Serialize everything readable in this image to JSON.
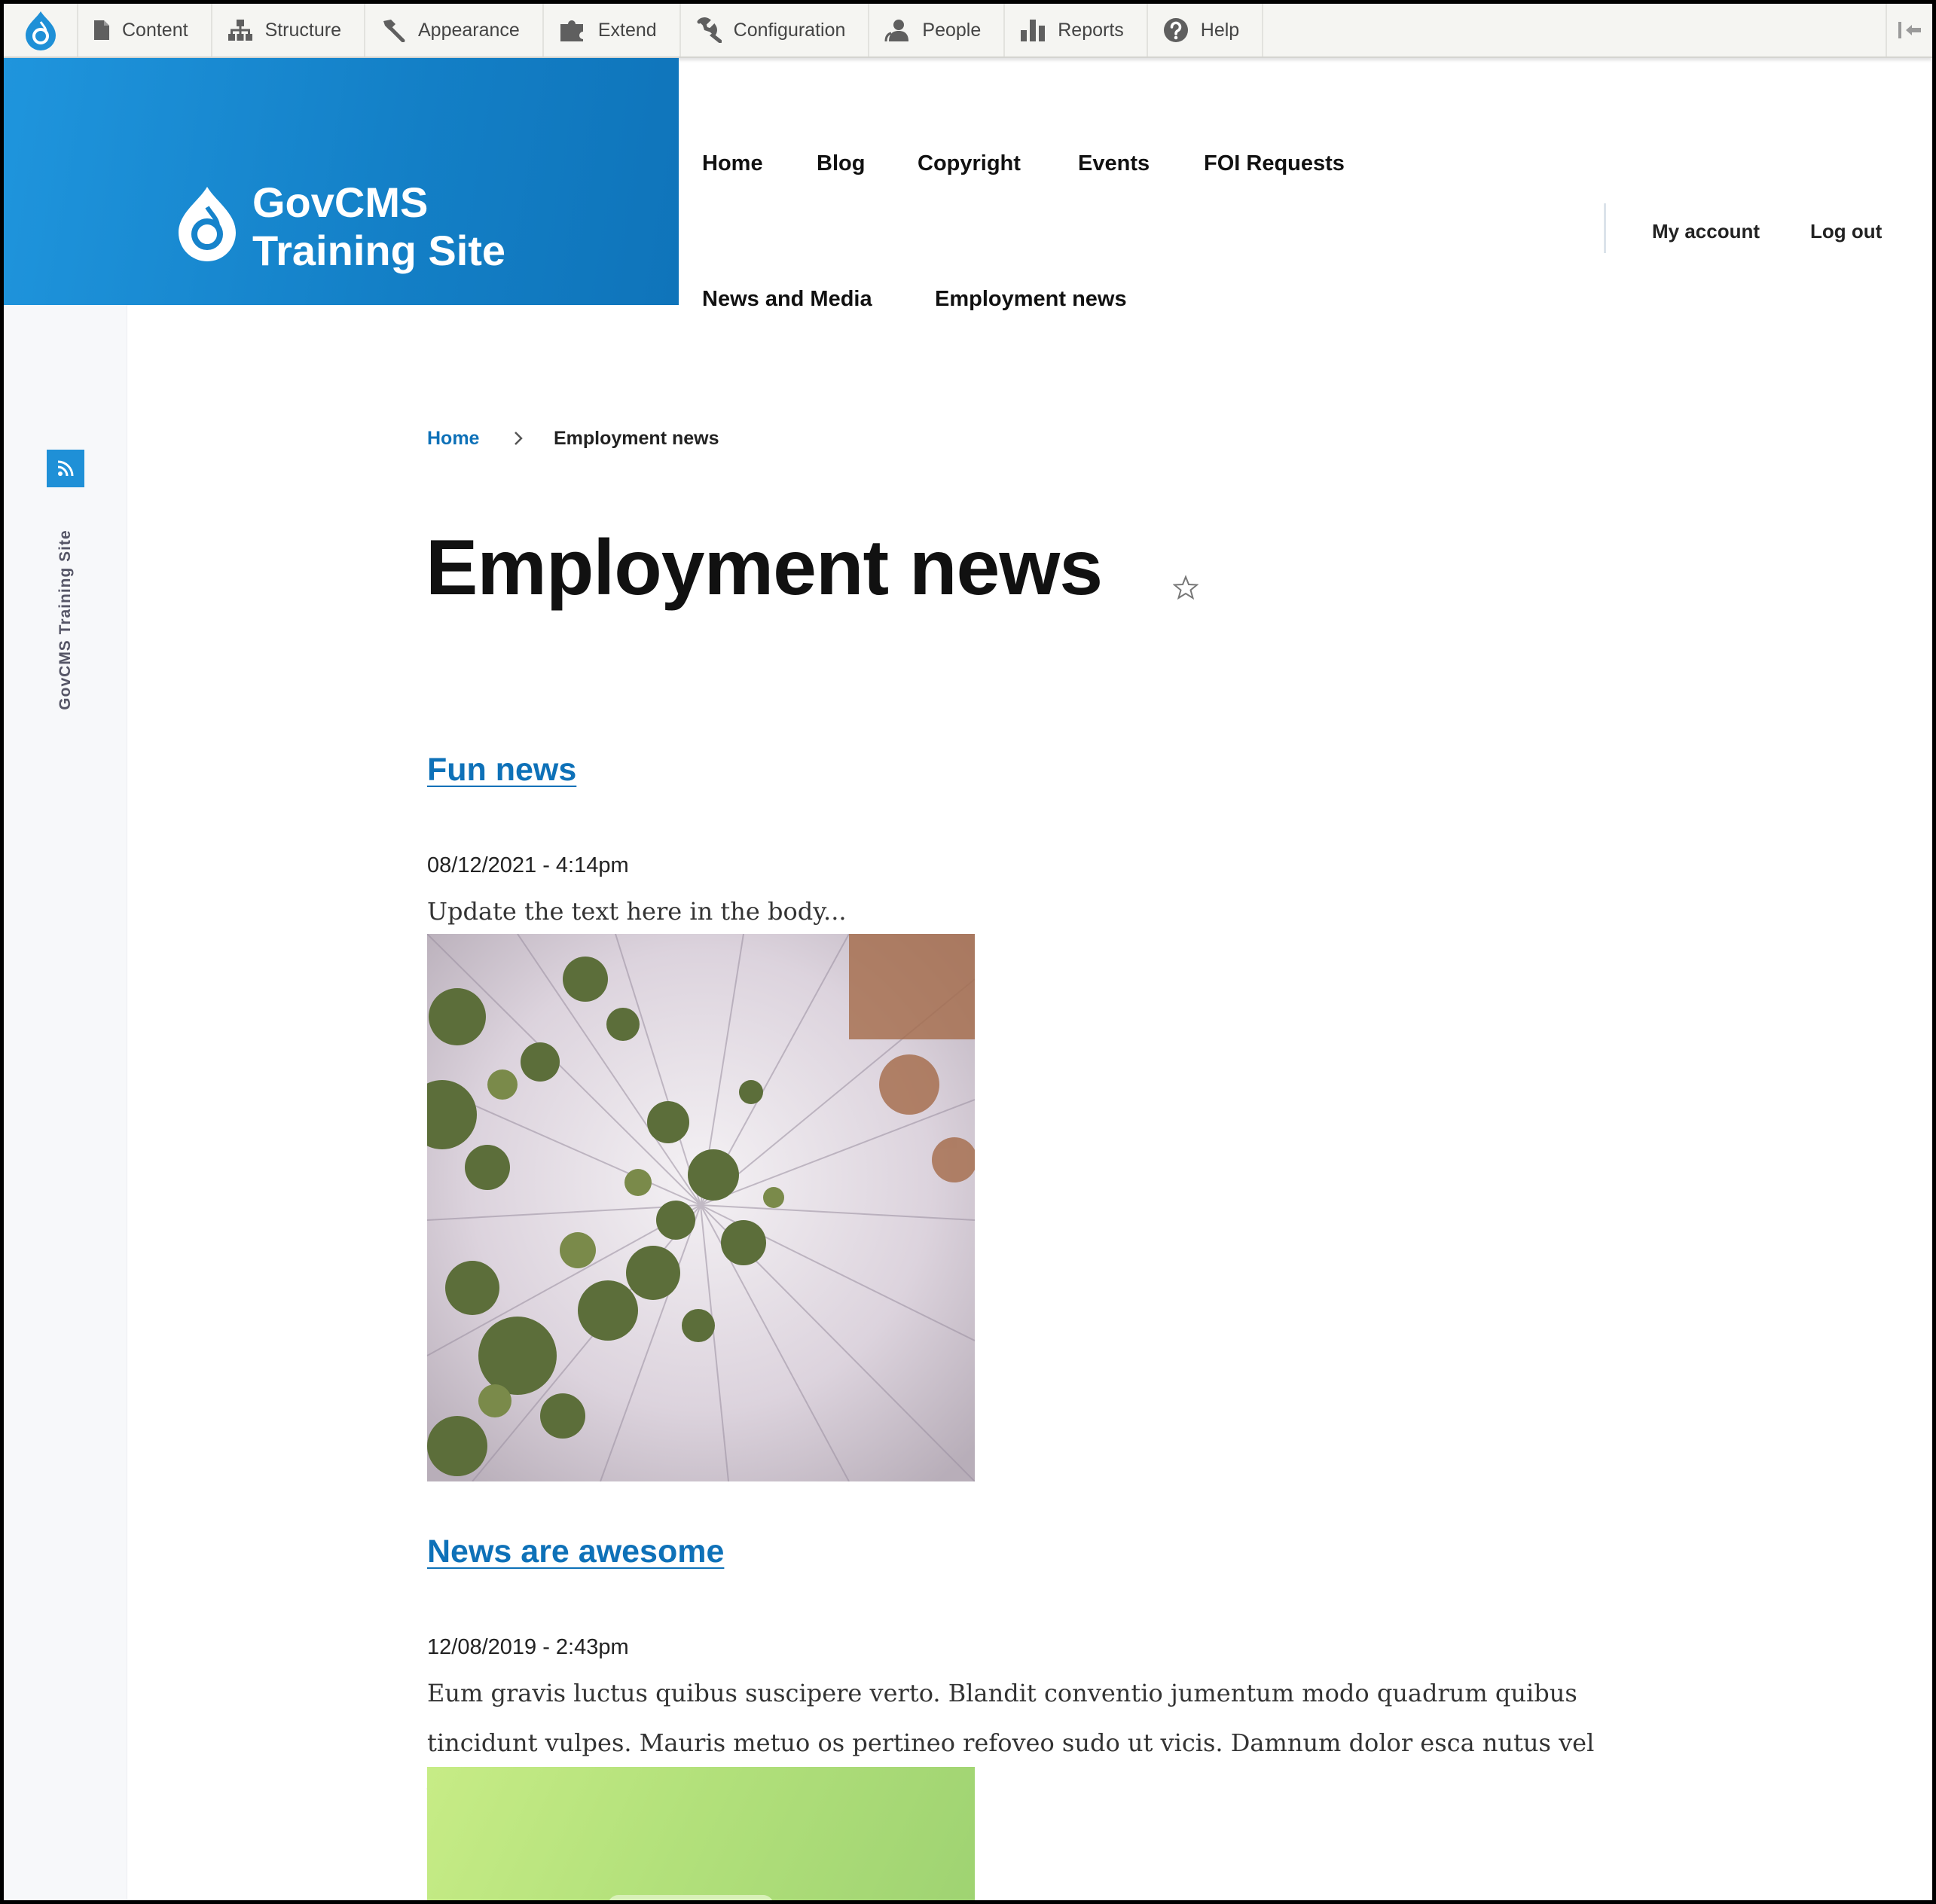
{
  "toolbar": {
    "items": [
      {
        "label": "Content",
        "icon": "file-icon"
      },
      {
        "label": "Structure",
        "icon": "sitemap-icon"
      },
      {
        "label": "Appearance",
        "icon": "brush-icon"
      },
      {
        "label": "Extend",
        "icon": "puzzle-icon"
      },
      {
        "label": "Configuration",
        "icon": "wrench-icon"
      },
      {
        "label": "People",
        "icon": "person-icon"
      },
      {
        "label": "Reports",
        "icon": "bar-chart-icon"
      },
      {
        "label": "Help",
        "icon": "help-icon"
      }
    ]
  },
  "sidebar": {
    "label": "GovCMS Training Site"
  },
  "branding": {
    "line1": "GovCMS",
    "line2": "Training Site",
    "color": "#1a8ad2"
  },
  "main_nav": {
    "items": [
      "Home",
      "Blog",
      "Copyright",
      "Events",
      "FOI Requests",
      "News and Media",
      "Employment news"
    ]
  },
  "account_nav": {
    "my_account": "My account",
    "log_out": "Log out"
  },
  "breadcrumb": {
    "home": "Home",
    "current": "Employment news"
  },
  "page": {
    "title": "Employment news"
  },
  "articles": [
    {
      "title": "Fun news",
      "date": "08/12/2021 - 4:14pm",
      "body": "Update the text here in the body..."
    },
    {
      "title": "News are awesome",
      "date": "12/08/2019 - 2:43pm",
      "body": "Eum gravis luctus quibus suscipere verto. Blandit conventio jumentum modo quadrum quibus tincidunt vulpes. Mauris metuo os pertineo refoveo sudo ut vicis. Damnum dolor esca nutus vel verto."
    }
  ],
  "colors": {
    "link": "#0e71b8",
    "accent": "#1f90d7"
  }
}
